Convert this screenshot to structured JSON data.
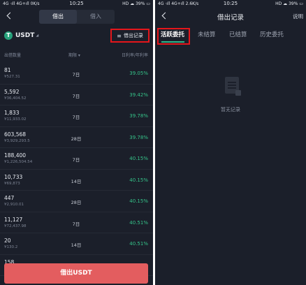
{
  "left": {
    "status": {
      "left": "4G ⋅ıll 4G+ıll 0K/s",
      "time": "10:25",
      "right": "HD ☁ 39% ▭"
    },
    "segment": {
      "active": "借出",
      "inactive": "借入"
    },
    "coin": {
      "name": "USDT",
      "icon_letter": "T",
      "icon_color": "#26a17b"
    },
    "records_button": {
      "label": "借出记录",
      "icon": "list-icon"
    },
    "columns": {
      "qty": "出借数量",
      "term": "期限",
      "rate": "日利率/年利率"
    },
    "rows": [
      {
        "qty": "81",
        "value": "¥527.31",
        "term": "7日",
        "rate": "39.05%"
      },
      {
        "qty": "5,592",
        "value": "¥36,404.52",
        "term": "7日",
        "rate": "39.42%"
      },
      {
        "qty": "1,833",
        "value": "¥11,933.02",
        "term": "7日",
        "rate": "39.78%"
      },
      {
        "qty": "603,568",
        "value": "¥3,929,293.5",
        "term": "28日",
        "rate": "39.78%"
      },
      {
        "qty": "188,400",
        "value": "¥1,226,504.54",
        "term": "7日",
        "rate": "40.15%"
      },
      {
        "qty": "10,733",
        "value": "¥69,873",
        "term": "14日",
        "rate": "40.15%"
      },
      {
        "qty": "447",
        "value": "¥2,910.01",
        "term": "28日",
        "rate": "40.15%"
      },
      {
        "qty": "11,127",
        "value": "¥72,437.98",
        "term": "7日",
        "rate": "40.51%"
      },
      {
        "qty": "20",
        "value": "¥130.2",
        "term": "14日",
        "rate": "40.51%"
      },
      {
        "qty": "158",
        "value": "",
        "term": "",
        "rate": ""
      }
    ],
    "cta_label": "借出USDT",
    "accent_red": "#e35d5f",
    "rate_color": "#35c48a"
  },
  "right": {
    "status": {
      "left": "4G ⋅ıll 4G+ıll 2.6K/s",
      "time": "10:25",
      "right": "HD ☁ 39% ▭"
    },
    "title": "借出记录",
    "help": "说明",
    "tabs": [
      "活跃委托",
      "未结算",
      "已结算",
      "历史委托"
    ],
    "active_tab_index": 0,
    "empty_text": "暂无记录",
    "empty_icon": "document-icon",
    "highlight_color": "#e5161b"
  }
}
